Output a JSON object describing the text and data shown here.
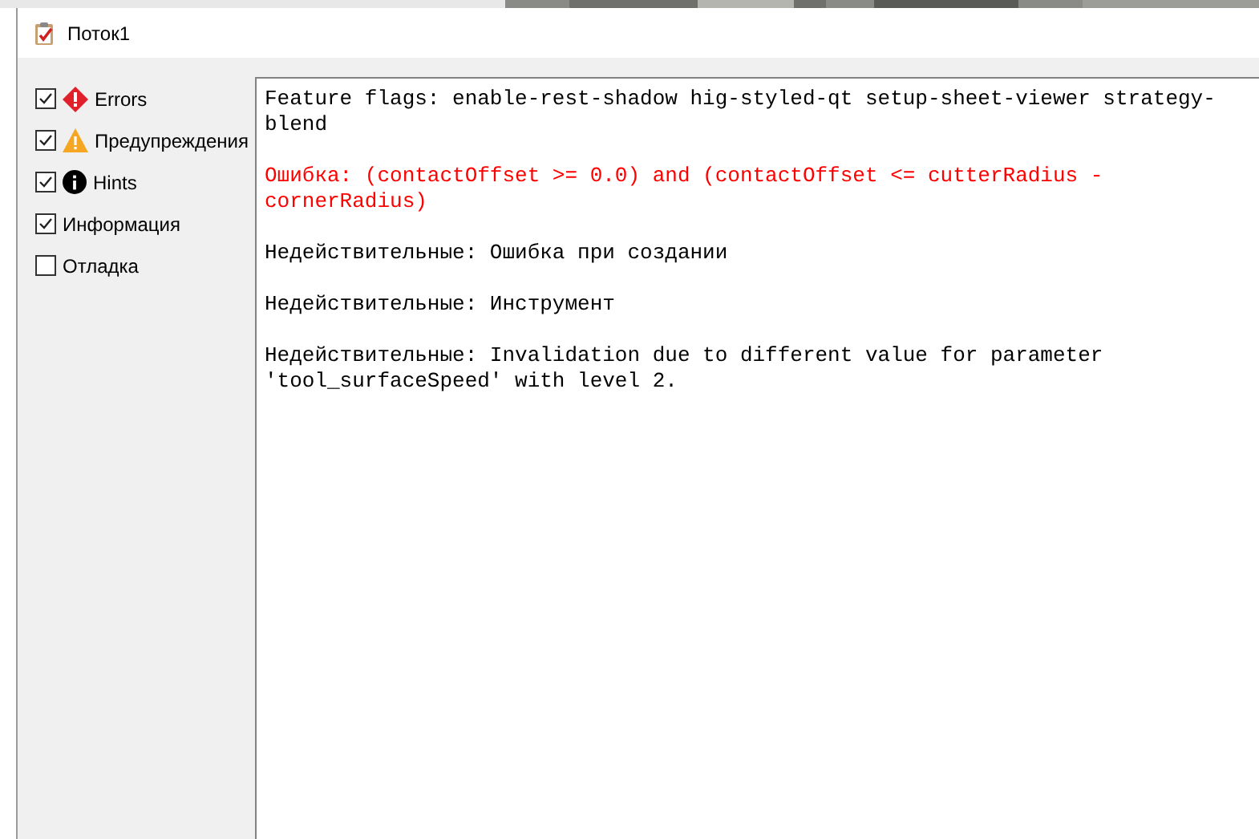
{
  "window": {
    "title": "Поток1"
  },
  "filters": [
    {
      "label": "Errors",
      "checked": true,
      "kind": "error"
    },
    {
      "label": "Предупреждения",
      "checked": true,
      "kind": "warning"
    },
    {
      "label": "Hints",
      "checked": true,
      "kind": "hint"
    },
    {
      "label": "Информация",
      "checked": true,
      "kind": "info"
    },
    {
      "label": "Отладка",
      "checked": false,
      "kind": "debug"
    }
  ],
  "messages": [
    {
      "text": "Feature flags: enable-rest-shadow hig-styled-qt setup-sheet-viewer strategy-blend",
      "kind": "normal"
    },
    {
      "text": "Ошибка: (contactOffset >= 0.0) and (contactOffset <= cutterRadius - cornerRadius)",
      "kind": "error"
    },
    {
      "text": "Недействительные: Ошибка при создании",
      "kind": "normal"
    },
    {
      "text": "Недействительные: Инструмент",
      "kind": "normal"
    },
    {
      "text": "Недействительные: Invalidation due to different value for parameter 'tool_surfaceSpeed' with level 2.",
      "kind": "normal"
    }
  ]
}
